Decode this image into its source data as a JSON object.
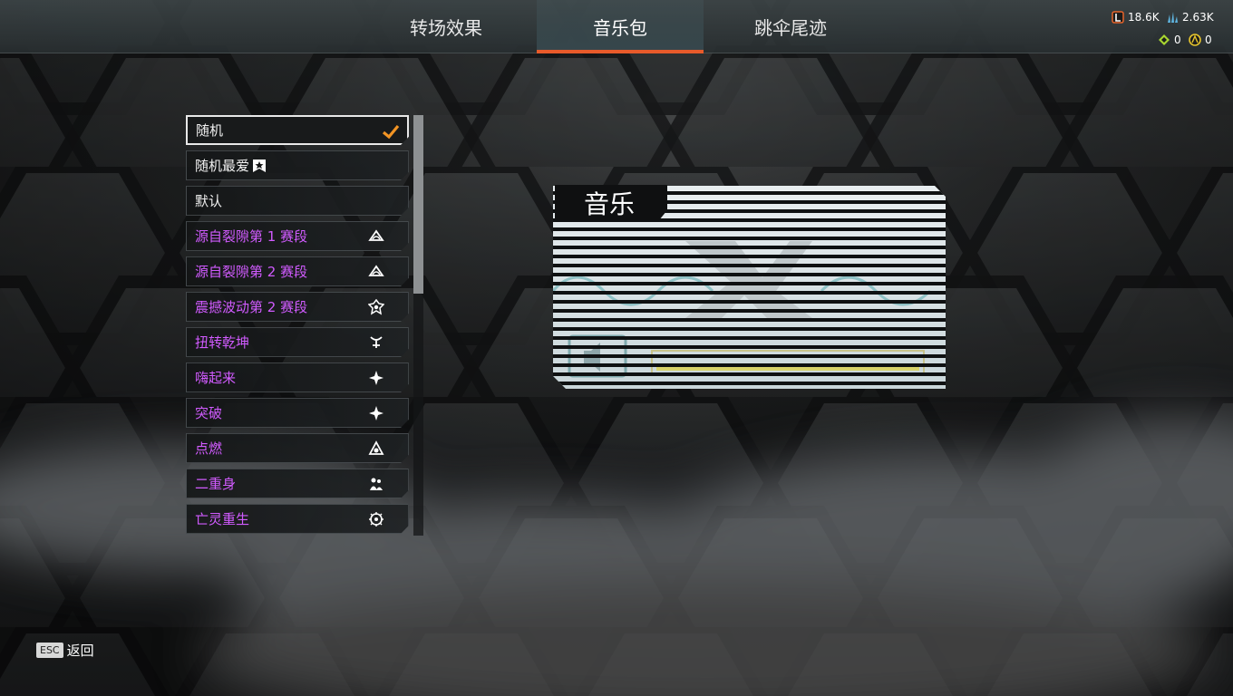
{
  "tabs": [
    {
      "label": "转场效果"
    },
    {
      "label": "音乐包",
      "active": true
    },
    {
      "label": "跳伞尾迹"
    }
  ],
  "currency": {
    "legend_tokens": "18.6K",
    "crafting_metals": "2.63K",
    "exotic_shards": "0",
    "apex_coins": "0"
  },
  "list": {
    "items": [
      {
        "label": "随机",
        "selected": true,
        "icon": "checkmark-icon"
      },
      {
        "label": "随机最爱",
        "icon": "favorite-badge-icon"
      },
      {
        "label": "默认"
      },
      {
        "label": "源自裂隙第 1 赛段",
        "icon": "rift-icon"
      },
      {
        "label": "源自裂隙第 2 赛段",
        "icon": "rift-icon"
      },
      {
        "label": "震撼波动第 2 赛段",
        "icon": "shockwave-icon"
      },
      {
        "label": "扭转乾坤",
        "icon": "twist-icon"
      },
      {
        "label": "嗨起来",
        "icon": "spark-icon"
      },
      {
        "label": "突破",
        "icon": "spark-icon"
      },
      {
        "label": "点燃",
        "icon": "ignite-icon"
      },
      {
        "label": "二重身",
        "icon": "doppel-icon"
      },
      {
        "label": "亡灵重生",
        "icon": "revenant-icon"
      }
    ]
  },
  "preview": {
    "title": "音乐",
    "icon": "speaker-icon"
  },
  "footer": {
    "esc_key": "ESC",
    "back_label": "返回"
  },
  "colors": {
    "accent": "#e85a2a",
    "purple_text": "#d15bff",
    "check": "#f29424"
  }
}
